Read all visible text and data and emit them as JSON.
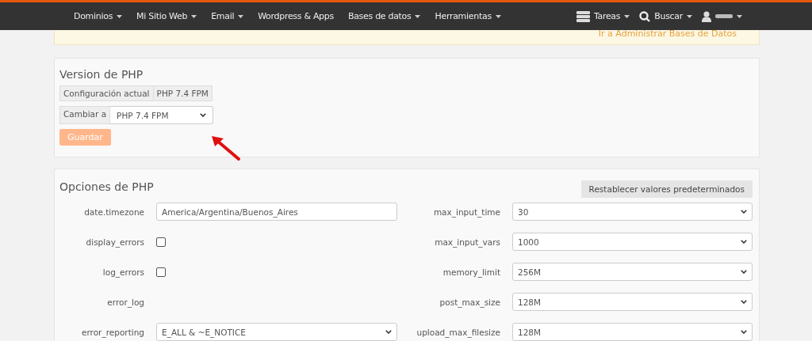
{
  "navbar": {
    "menu": [
      {
        "label": "Dominios",
        "dropdown": true
      },
      {
        "label": "Mi Sitio Web",
        "dropdown": true
      },
      {
        "label": "Email",
        "dropdown": true
      },
      {
        "label": "Wordpress & Apps",
        "dropdown": false
      },
      {
        "label": "Bases de datos",
        "dropdown": true
      },
      {
        "label": "Herramientas",
        "dropdown": true
      }
    ],
    "right": [
      {
        "kind": "tasks",
        "label": "Tareas",
        "dropdown": true
      },
      {
        "kind": "search",
        "label": "Buscar",
        "dropdown": true
      },
      {
        "kind": "user",
        "dropdown": true
      }
    ]
  },
  "banner": {
    "link": "Ir a Administrar Bases de Datos"
  },
  "php_version": {
    "title": "Version de PHP",
    "current_label": "Configuración actual",
    "current_value": "PHP 7.4 FPM",
    "change_label": "Cambiar a",
    "change_value": "PHP 7.4 FPM",
    "save_button": "Guardar",
    "save_disabled": true
  },
  "php_options": {
    "title": "Opciones de PHP",
    "reset_button": "Restablecer valores predeterminados",
    "left": [
      {
        "label": "date.timezone",
        "kind": "input",
        "value": "America/Argentina/Buenos_Aires"
      },
      {
        "label": "display_errors",
        "kind": "checkbox",
        "checked": false
      },
      {
        "label": "log_errors",
        "kind": "checkbox",
        "checked": false
      },
      {
        "label": "error_log",
        "kind": "empty"
      },
      {
        "label": "error_reporting",
        "kind": "select",
        "value": "E_ALL & ~E_NOTICE"
      }
    ],
    "right": [
      {
        "label": "max_input_time",
        "kind": "select",
        "value": "30"
      },
      {
        "label": "max_input_vars",
        "kind": "select",
        "value": "1000"
      },
      {
        "label": "memory_limit",
        "kind": "select",
        "value": "256M"
      },
      {
        "label": "post_max_size",
        "kind": "select",
        "value": "128M"
      },
      {
        "label": "upload_max_filesize",
        "kind": "select",
        "value": "128M"
      }
    ]
  }
}
